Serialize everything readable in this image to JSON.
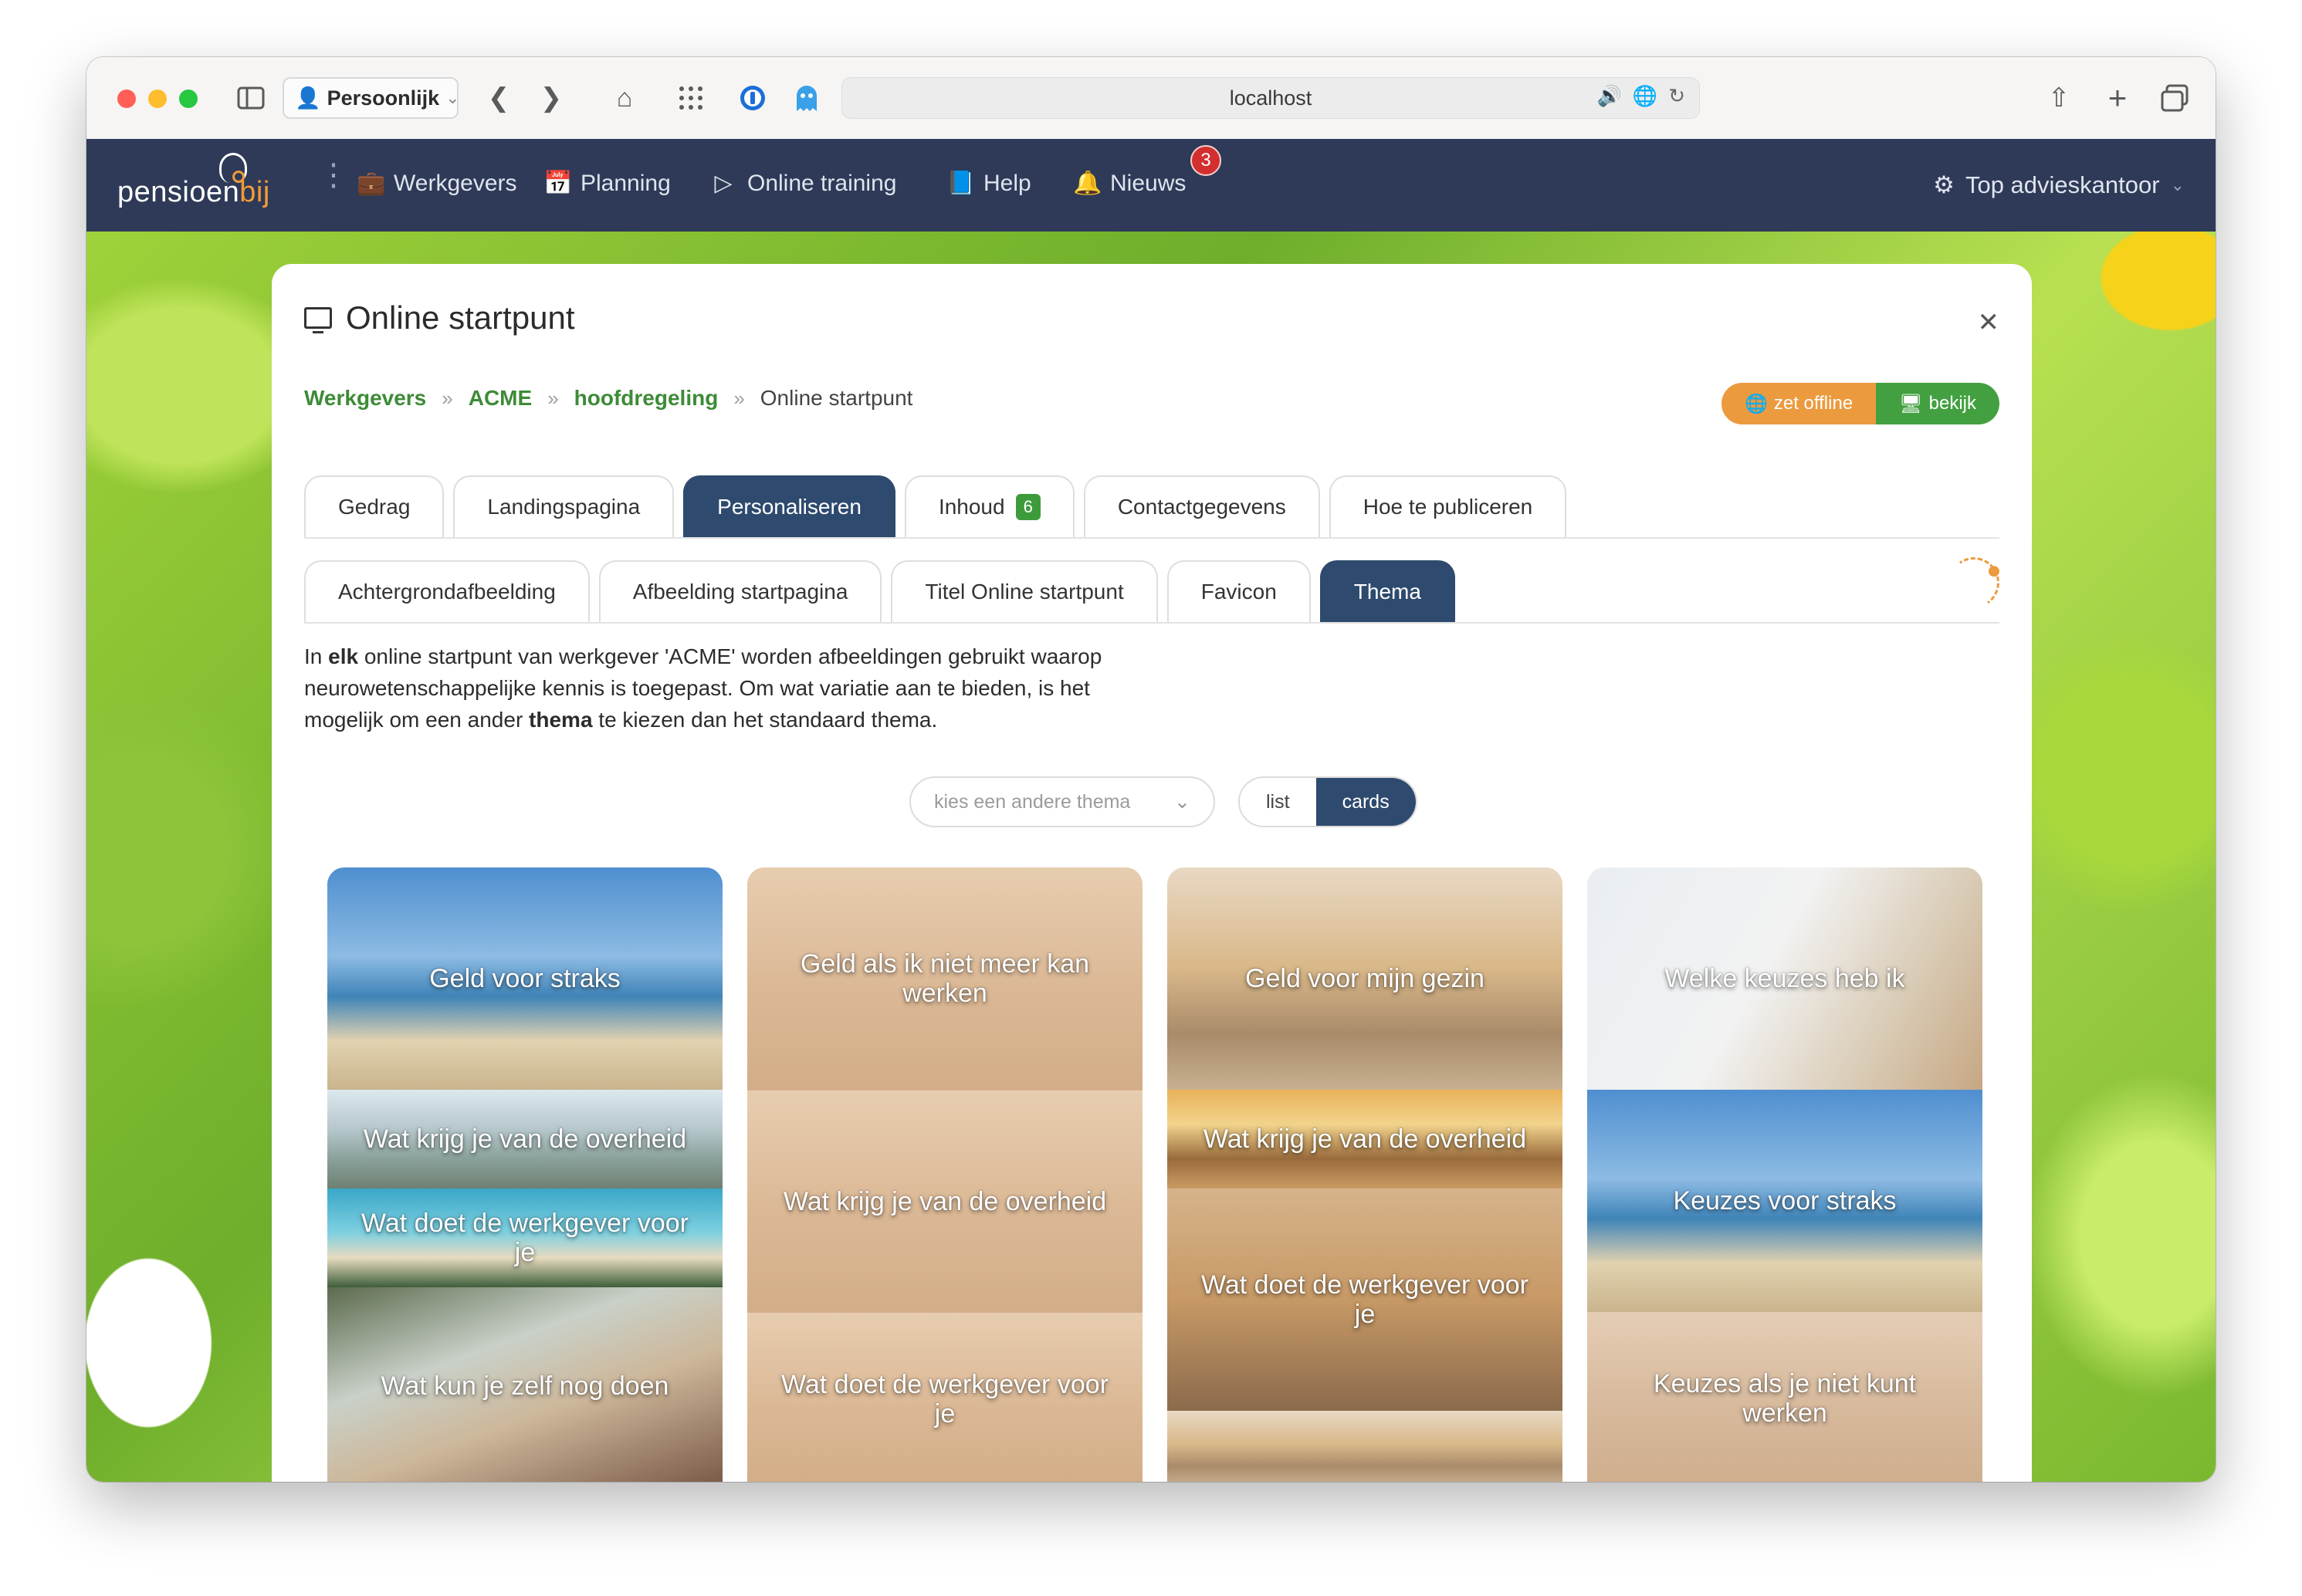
{
  "browser": {
    "profile_label": "Persoonlijk",
    "url": "localhost"
  },
  "nav": {
    "logo_main": "pensioen",
    "logo_accent": "bij",
    "items": [
      {
        "label": "Werkgevers",
        "icon": "briefcase-icon"
      },
      {
        "label": "Planning",
        "icon": "calendar-icon"
      },
      {
        "label": "Online training",
        "icon": "play-circle-icon"
      },
      {
        "label": "Help",
        "icon": "book-icon"
      },
      {
        "label": "Nieuws",
        "icon": "bell-icon"
      }
    ],
    "news_badge": "3",
    "account_label": "Top advieskantoor"
  },
  "panel": {
    "title": "Online startpunt",
    "breadcrumb": [
      "Werkgevers",
      "ACME",
      "hoofdregeling"
    ],
    "breadcrumb_current": "Online startpunt",
    "offline_label": "zet offline",
    "view_label": "bekijk",
    "tabs_row1": [
      "Gedrag",
      "Landingspagina",
      "Personaliseren",
      "Inhoud",
      "Contactgegevens",
      "Hoe te publiceren"
    ],
    "inhoud_count": "6",
    "tabs_row2": [
      "Achtergrondafbeelding",
      "Afbeelding startpagina",
      "Titel Online startpunt",
      "Favicon",
      "Thema"
    ],
    "desc": {
      "p1": "In ",
      "b1": "elk",
      "p2": " online startpunt van werkgever 'ACME' worden afbeeldingen gebruikt waarop neurowetenschappelijke kennis is toegepast. Om wat variatie aan te bieden, is het mogelijk om een ander ",
      "b2": "thema",
      "p3": " te kiezen dan het standaard thema."
    },
    "select_placeholder": "kies een andere thema",
    "toggle_list": "list",
    "toggle_cards": "cards"
  },
  "cards": [
    [
      "Geld voor straks",
      "Wat krijg je van de overheid",
      "Wat doet de werkgever voor je",
      "Wat kun je zelf nog doen"
    ],
    [
      "Geld als ik niet meer kan werken",
      "Wat krijg je van de overheid",
      "Wat doet de werkgever voor je"
    ],
    [
      "Geld voor mijn gezin",
      "Wat krijg je van de overheid",
      "Wat doet de werkgever voor je"
    ],
    [
      "Welke keuzes heb ik",
      "Keuzes voor straks",
      "Keuzes als je niet kunt werken"
    ]
  ],
  "colors": {
    "nav_bg": "#2e3a57",
    "active_tab": "#2e4a6e",
    "link_green": "#3d8b37",
    "offline_orange": "#ec9a3e",
    "bekijk_green": "#43a040"
  }
}
